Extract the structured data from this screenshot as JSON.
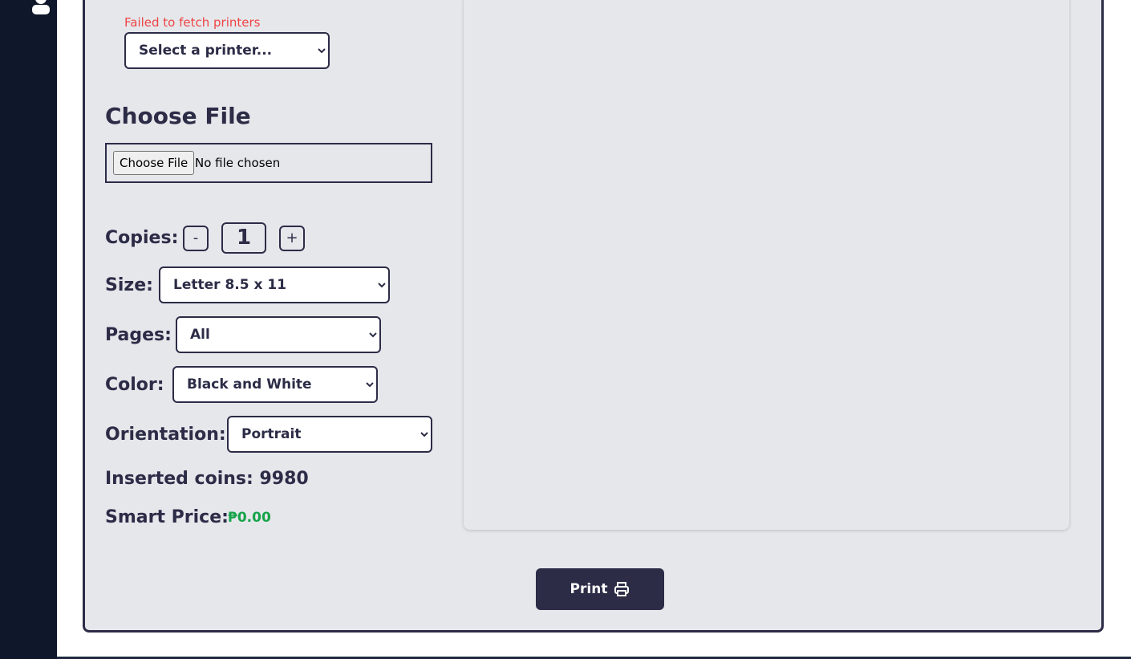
{
  "sidebar": {
    "user_icon": "user-icon"
  },
  "printer": {
    "error": "Failed to fetch printers",
    "selected": "Select a printer..."
  },
  "file": {
    "title": "Choose File",
    "button_label": "Choose File",
    "status": "No file chosen"
  },
  "copies": {
    "label": "Copies:",
    "minus": "-",
    "plus": "+",
    "value": "1"
  },
  "size": {
    "label": "Size:",
    "selected": "Letter 8.5 x 11"
  },
  "pages": {
    "label": "Pages:",
    "selected": "All"
  },
  "color": {
    "label": "Color:",
    "selected": "Black and White"
  },
  "orientation": {
    "label": "Orientation:",
    "selected": "Portrait"
  },
  "coins": {
    "label": "Inserted coins: 9980"
  },
  "price": {
    "label": "Smart Price:",
    "value": "₱0.00"
  },
  "print": {
    "label": "Print",
    "icon": "printer-icon"
  },
  "colors": {
    "sidebar": "#0f172a",
    "card_bg": "#e5e7eb",
    "primary": "#2c2c47",
    "error": "#ef4444",
    "price": "#16a34a"
  }
}
